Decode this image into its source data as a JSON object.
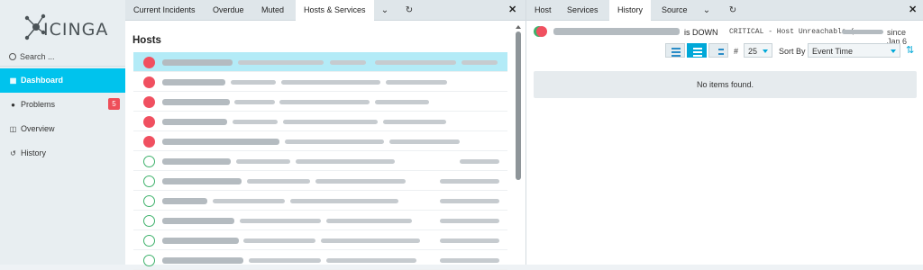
{
  "sidebar": {
    "logo_text": "ICINGA",
    "search_placeholder": "Search ...",
    "items": [
      {
        "label": "Dashboard",
        "glyph": "▦",
        "active": true
      },
      {
        "label": "Problems",
        "glyph": "●",
        "badge": "5"
      },
      {
        "label": "Overview",
        "glyph": "◫"
      },
      {
        "label": "History",
        "glyph": "↺"
      }
    ]
  },
  "left_tabs": {
    "items": [
      "Current Incidents",
      "Overdue",
      "Muted",
      "Hosts & Services"
    ],
    "active": "Hosts & Services"
  },
  "left_pane": {
    "title": "Hosts",
    "rows": [
      {
        "state": "down",
        "selected": true
      },
      {
        "state": "down"
      },
      {
        "state": "down"
      },
      {
        "state": "down"
      },
      {
        "state": "down"
      },
      {
        "state": "up"
      },
      {
        "state": "up"
      },
      {
        "state": "up"
      },
      {
        "state": "up"
      },
      {
        "state": "up"
      },
      {
        "state": "up"
      }
    ]
  },
  "right_tabs": {
    "items": [
      "Host",
      "Services",
      "History",
      "Source"
    ],
    "active": "History"
  },
  "detail": {
    "status_text": "is DOWN",
    "output_text": "CRITICAL - Host Unreachable (",
    "since_text": "since Jan 6"
  },
  "history_controls": {
    "limit_hash": "#",
    "limit_value": "25",
    "sort_label": "Sort By",
    "sort_value": "Event Time"
  },
  "empty_message": "No items found.",
  "colors": {
    "accent": "#00c3ed",
    "down": "#f05060",
    "up": "#3fb26c",
    "badge": "#ee4e59"
  }
}
